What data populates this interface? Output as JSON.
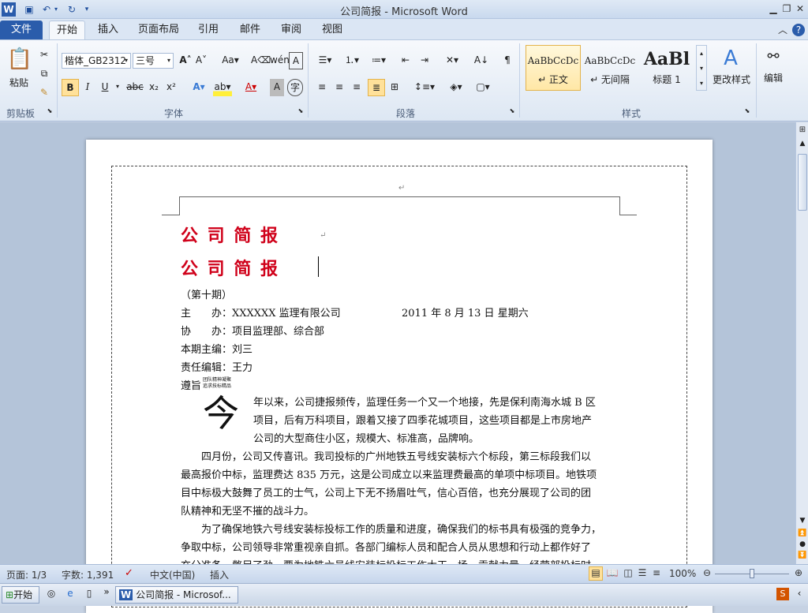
{
  "window": {
    "title": "公司简报 - Microsoft Word"
  },
  "tabs": [
    {
      "label": "文件"
    },
    {
      "label": "开始"
    },
    {
      "label": "插入"
    },
    {
      "label": "页面布局"
    },
    {
      "label": "引用"
    },
    {
      "label": "邮件"
    },
    {
      "label": "审阅"
    },
    {
      "label": "视图"
    }
  ],
  "ribbon": {
    "clipboard": {
      "paste": "粘贴",
      "label": "剪贴板"
    },
    "font": {
      "name": "楷体_GB2312",
      "size": "三号",
      "label": "字体",
      "bold": "B",
      "italic": "I",
      "underline": "U"
    },
    "paragraph": {
      "label": "段落"
    },
    "styles": {
      "label": "样式",
      "items": [
        {
          "preview": "AaBbCcDc",
          "name": "↵ 正文"
        },
        {
          "preview": "AaBbCcDc",
          "name": "↵ 无间隔"
        },
        {
          "preview": "AaBl",
          "name": "标题 1"
        }
      ],
      "change": "更改样式"
    },
    "editing": {
      "label": "编辑"
    }
  },
  "document": {
    "title1": "公 司 简 报",
    "title2": "公 司 简 报",
    "issue": "（第十期）",
    "host": "主　　办：XXXXXX 监理有限公司",
    "date": "2011 年 8 月  13 日      星期六",
    "cohost": "协　　办：项目监理部、综合部",
    "editor": "本期主编：刘三",
    "resp": "责任编辑：王力",
    "motto": "遵旨",
    "motto_small1": "团队精神凝聚",
    "motto_small2": "追求技标精品",
    "dropcap": "今",
    "p1_l1": "年以来，公司捷报频传，监理任务一个又一个地接，先是保利南海水城 B 区",
    "p1_l2": "项目，后有万科项目，跟着又接了四季花城项目，这些项目都是上市房地产",
    "p1_l3": "公司的大型商住小区，规模大、标准高，品牌响。",
    "p2_l1": "四月份，公司又传喜讯。我司投标的广州地铁五号线安装标六个标段，第三标段我们以",
    "p2_l2": "最高报价中标，监理费达 835 万元，这是公司成立以来监理费最高的单项中标项目。地铁项",
    "p2_l3": "目中标极大鼓舞了员工的士气，公司上下无不扬眉吐气，信心百倍，也充分展现了公司的团",
    "p2_l4": "队精神和无坚不摧的战斗力。",
    "p3_l1": "为了确保地铁六号线安装标投标工作的质量和进度，确保我们的标书具有极强的竞争力，",
    "p3_l2": "争取中标，公司领导非常重视亲自抓。各部门编标人员和配合人员从思想和行动上都作好了",
    "p3_l3": "充分准备，憋足了劲，要为地铁六号线安装标投标工作大干一场，贡献力量。经营部投标时，"
  },
  "status": {
    "page": "页面: 1/3",
    "words": "字数: 1,391",
    "lang": "中文(中国)",
    "mode": "插入",
    "zoom": "100%"
  },
  "taskbar": {
    "start": "开始",
    "task": "公司简报 - Microsof..."
  },
  "colors": {
    "accent": "#2a5cab",
    "title_red": "#d0021b"
  }
}
